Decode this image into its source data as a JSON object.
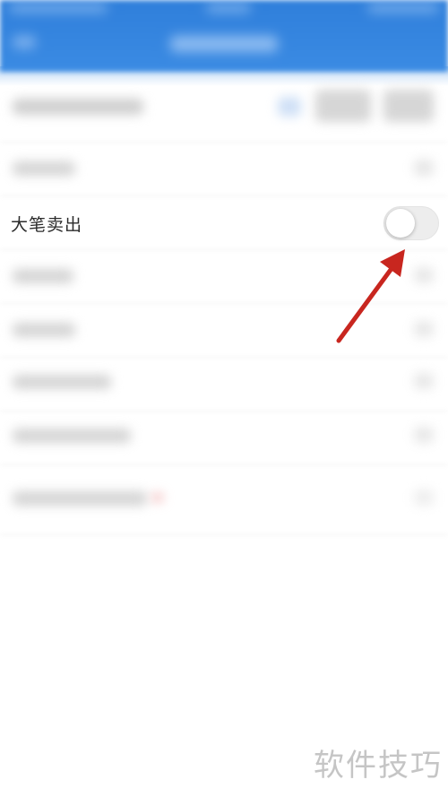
{
  "setting": {
    "label": "大笔卖出",
    "enabled": false
  },
  "watermark": "软件技巧",
  "colors": {
    "header": "#2f7fdb",
    "arrow": "#c8261f",
    "toggle_off": "#ededed"
  }
}
